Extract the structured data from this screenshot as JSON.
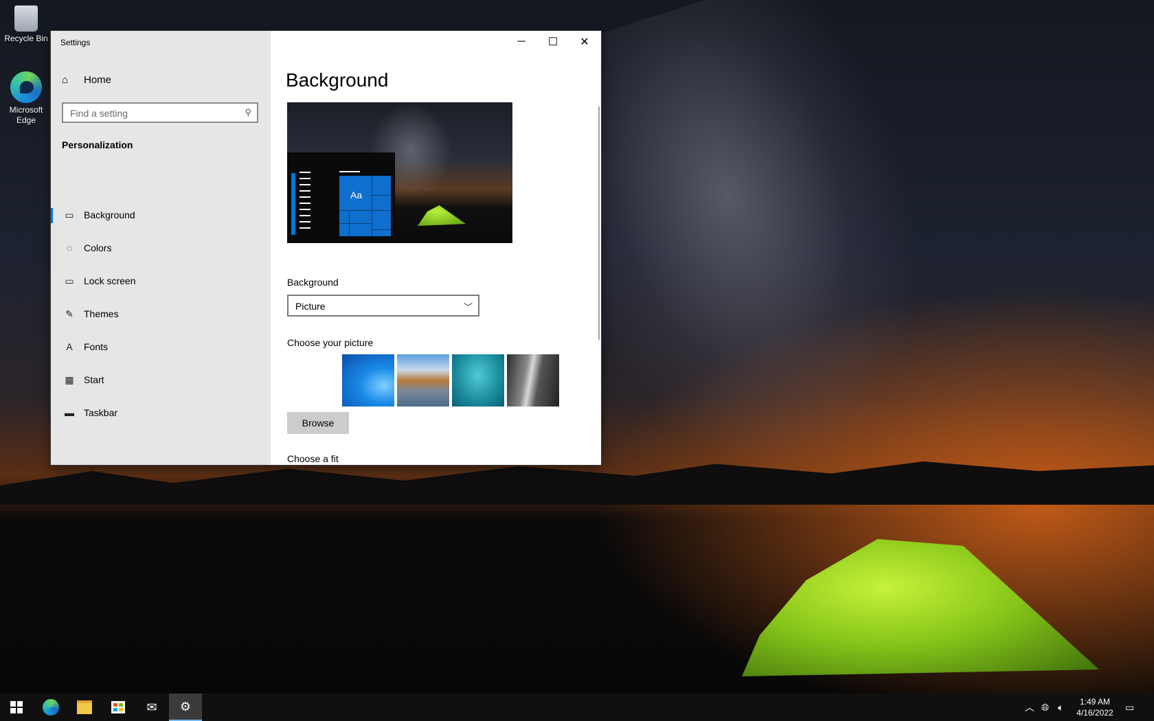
{
  "desktop": {
    "icons": [
      {
        "label": "Recycle Bin"
      },
      {
        "label": "Microsoft Edge"
      }
    ]
  },
  "window": {
    "title": "Settings",
    "controls": {
      "minimize": "─",
      "maximize": "☐",
      "close": "✕"
    }
  },
  "sidebar": {
    "home_label": "Home",
    "search_placeholder": "Find a setting",
    "section_title": "Personalization",
    "items": [
      {
        "label": "Background",
        "icon": "picture-icon",
        "glyph": "▭",
        "active": true
      },
      {
        "label": "Colors",
        "icon": "palette-icon",
        "glyph": "◌"
      },
      {
        "label": "Lock screen",
        "icon": "lock-screen-icon",
        "glyph": "▭"
      },
      {
        "label": "Themes",
        "icon": "brush-icon",
        "glyph": "✎"
      },
      {
        "label": "Fonts",
        "icon": "font-icon",
        "glyph": "A"
      },
      {
        "label": "Start",
        "icon": "start-icon",
        "glyph": "▦"
      },
      {
        "label": "Taskbar",
        "icon": "taskbar-icon",
        "glyph": "▬"
      }
    ]
  },
  "main": {
    "title": "Background",
    "preview_tile_text": "Aa",
    "background_label": "Background",
    "background_value": "Picture",
    "choose_picture_label": "Choose your picture",
    "browse_label": "Browse",
    "choose_fit_label": "Choose a fit"
  },
  "taskbar": {
    "apps": [
      "start-icon",
      "edge-icon",
      "file-explorer-icon",
      "store-icon",
      "mail-icon",
      "settings-icon"
    ],
    "time": "1:49 AM",
    "date": "4/16/2022"
  },
  "colors": {
    "accent": "#0078d7",
    "sidebar_bg": "#e6e6e6",
    "taskbar_bg": "#101010"
  }
}
